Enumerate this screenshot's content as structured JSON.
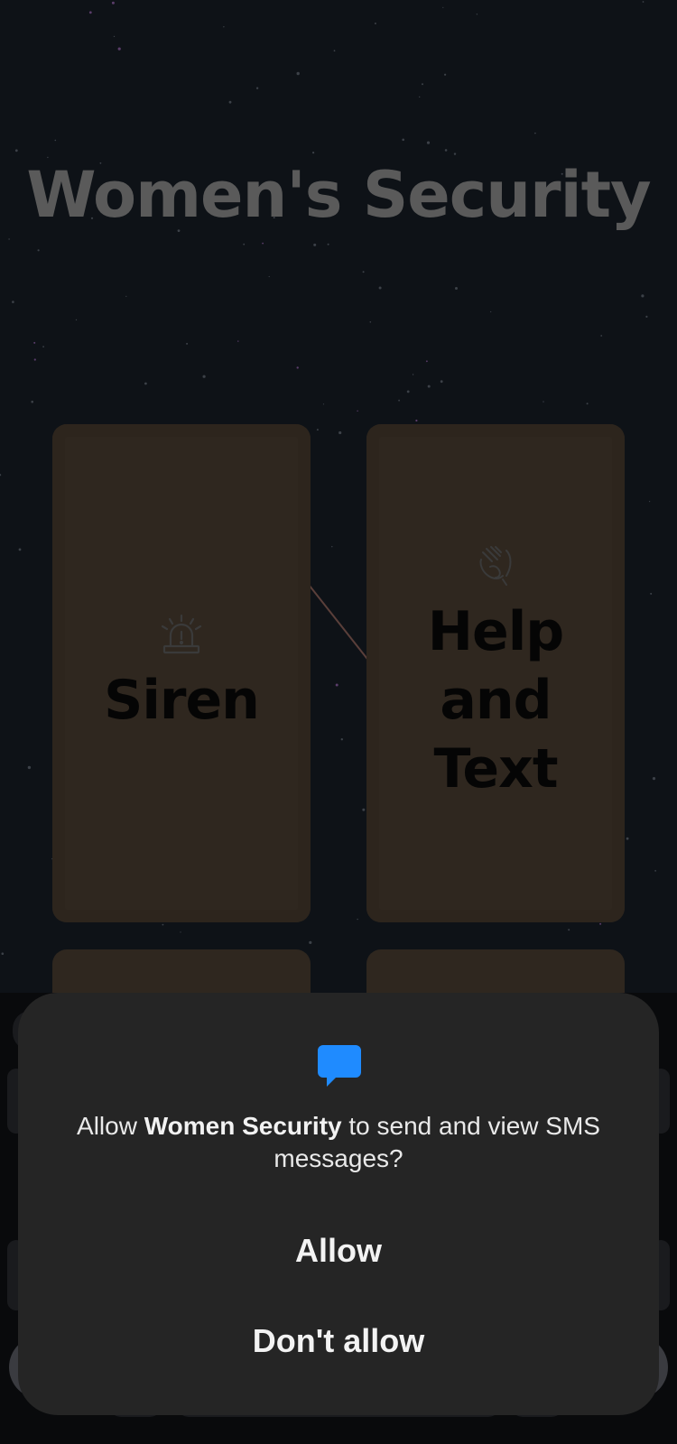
{
  "app": {
    "title": "Women's Security",
    "tiles": [
      {
        "label_lines": [
          "Siren"
        ],
        "icon": "siren-icon"
      },
      {
        "label_lines": [
          "Help",
          "and",
          "Text"
        ],
        "icon": "help-hands-icon"
      }
    ]
  },
  "permission_dialog": {
    "icon": "sms-message-icon",
    "message_prefix": "Allow ",
    "app_name": "Women Security",
    "message_suffix": " to send and view SMS messages?",
    "allow_label": "Allow",
    "deny_label": "Don't allow",
    "icon_color": "#1f8bff"
  }
}
